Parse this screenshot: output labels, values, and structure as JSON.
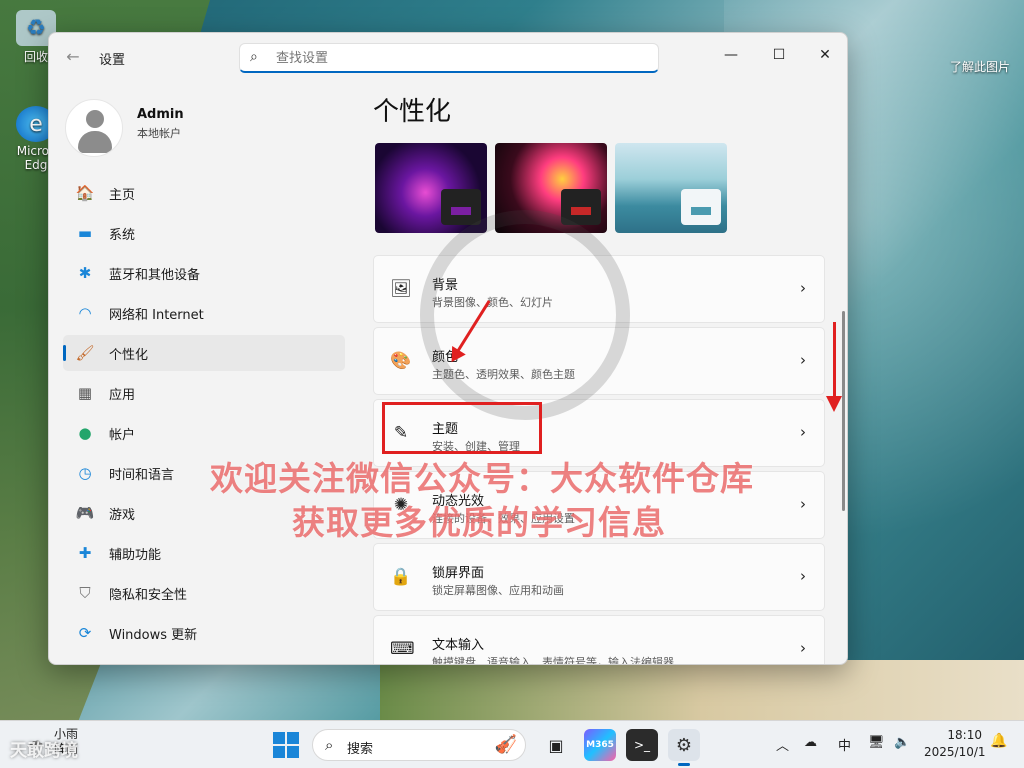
{
  "desktop": {
    "icons": [
      {
        "label": "回收",
        "icon": "recycle-bin-icon"
      },
      {
        "label": "Micros Edg",
        "icon": "edge-icon"
      },
      {
        "label": "了解此图片",
        "icon": "picture-info-icon"
      }
    ]
  },
  "window": {
    "title": "设置",
    "search_placeholder": "查找设置",
    "controls": {
      "minimize": "—",
      "maximize": "☐",
      "close": "✕"
    }
  },
  "profile": {
    "name": "Admin",
    "subtitle": "本地帐户"
  },
  "sidebar": {
    "items": [
      {
        "label": "主页",
        "icon": "home-icon",
        "glyph": "🏠"
      },
      {
        "label": "系统",
        "icon": "display-icon",
        "glyph": "▬"
      },
      {
        "label": "蓝牙和其他设备",
        "icon": "bluetooth-icon",
        "glyph": "✱"
      },
      {
        "label": "网络和 Internet",
        "icon": "wifi-icon",
        "glyph": "◠"
      },
      {
        "label": "个性化",
        "icon": "brush-icon",
        "glyph": "🖌",
        "active": true
      },
      {
        "label": "应用",
        "icon": "apps-icon",
        "glyph": "▦"
      },
      {
        "label": "帐户",
        "icon": "account-icon",
        "glyph": "●"
      },
      {
        "label": "时间和语言",
        "icon": "clock-globe-icon",
        "glyph": "◷"
      },
      {
        "label": "游戏",
        "icon": "gamepad-icon",
        "glyph": "🎮"
      },
      {
        "label": "辅助功能",
        "icon": "accessibility-icon",
        "glyph": "✚"
      },
      {
        "label": "隐私和安全性",
        "icon": "shield-icon",
        "glyph": "⛉"
      },
      {
        "label": "Windows 更新",
        "icon": "update-icon",
        "glyph": "⟳"
      }
    ]
  },
  "main": {
    "title": "个性化",
    "themes": [
      "theme-purple",
      "theme-flower",
      "theme-lake"
    ],
    "cards": [
      {
        "title": "背景",
        "subtitle": "背景图像、颜色、幻灯片",
        "icon": "picture-icon",
        "glyph": "🖼"
      },
      {
        "title": "颜色",
        "subtitle": "主题色、透明效果、颜色主题",
        "icon": "palette-icon",
        "glyph": "🎨"
      },
      {
        "title": "主题",
        "subtitle": "安装、创建、管理",
        "icon": "pen-icon",
        "glyph": "✎"
      },
      {
        "title": "动态光效",
        "subtitle": "连接的设备、效果、应用设置",
        "icon": "sparkle-icon",
        "glyph": "✺"
      },
      {
        "title": "锁屏界面",
        "subtitle": "锁定屏幕图像、应用和动画",
        "icon": "lock-screen-icon",
        "glyph": "🔒"
      },
      {
        "title": "文本输入",
        "subtitle": "触摸键盘、语音输入、表情符号等，输入法编辑器",
        "icon": "keyboard-icon",
        "glyph": "⌨"
      }
    ],
    "chevron": "›"
  },
  "watermark": {
    "line1": "欢迎关注微信公众号：大众软件仓库",
    "line2": "获取更多优质的学习信息"
  },
  "taskbar": {
    "weather_temp": "小雨",
    "weather_sub": "阵雨",
    "brand": "天敢跨境",
    "search_label": "搜索",
    "m365_label": "M365",
    "terminal_label": ">_",
    "ime_label": "中",
    "time": "18:10",
    "date": "2025/10/1"
  },
  "colors": {
    "accent": "#0067c0",
    "annotation": "#e02020"
  }
}
